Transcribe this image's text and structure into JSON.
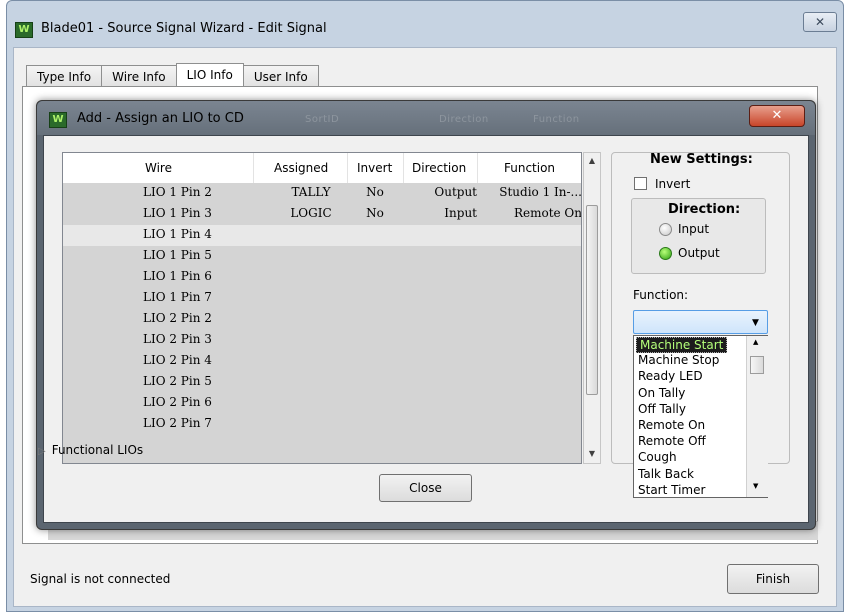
{
  "outer_window": {
    "title": "Blade01 - Source Signal Wizard - Edit Signal",
    "close_glyph": "✕"
  },
  "tabs": [
    "Type Info",
    "Wire Info",
    "LIO Info",
    "User Info"
  ],
  "active_tab": "LIO Info",
  "dialog": {
    "title": "Add - Assign an LIO to CD",
    "ghost_labels": [
      "SortID",
      "Direction",
      "Function"
    ],
    "close_glyph": "✕",
    "close_button": "Close"
  },
  "table": {
    "headers": [
      "Wire",
      "Assigned",
      "Invert",
      "Direction",
      "Function"
    ],
    "rows": [
      {
        "wire": "LIO 1 Pin 2",
        "assigned": "TALLY",
        "invert": "No",
        "direction": "Output",
        "function": "Studio 1 In-..."
      },
      {
        "wire": "LIO 1 Pin 3",
        "assigned": "LOGIC",
        "invert": "No",
        "direction": "Input",
        "function": "Remote On"
      },
      {
        "wire": "LIO 1 Pin 4",
        "assigned": "",
        "invert": "",
        "direction": "",
        "function": ""
      },
      {
        "wire": "LIO 1 Pin 5",
        "assigned": "",
        "invert": "",
        "direction": "",
        "function": ""
      },
      {
        "wire": "LIO 1 Pin 6",
        "assigned": "",
        "invert": "",
        "direction": "",
        "function": ""
      },
      {
        "wire": "LIO 1 Pin 7",
        "assigned": "",
        "invert": "",
        "direction": "",
        "function": ""
      },
      {
        "wire": "LIO 2 Pin 2",
        "assigned": "",
        "invert": "",
        "direction": "",
        "function": ""
      },
      {
        "wire": "LIO 2 Pin 3",
        "assigned": "",
        "invert": "",
        "direction": "",
        "function": ""
      },
      {
        "wire": "LIO 2 Pin 4",
        "assigned": "",
        "invert": "",
        "direction": "",
        "function": ""
      },
      {
        "wire": "LIO 2 Pin 5",
        "assigned": "",
        "invert": "",
        "direction": "",
        "function": ""
      },
      {
        "wire": "LIO 2 Pin 6",
        "assigned": "",
        "invert": "",
        "direction": "",
        "function": ""
      },
      {
        "wire": "LIO 2 Pin 7",
        "assigned": "",
        "invert": "",
        "direction": "",
        "function": ""
      }
    ],
    "highlighted_row": 2,
    "group_label": "Functional LIOs",
    "group_expander": "▷"
  },
  "settings": {
    "title": "New Settings:",
    "invert_label": "Invert",
    "invert_checked": false,
    "direction_title": "Direction:",
    "input_label": "Input",
    "output_label": "Output",
    "selected_direction": "Output",
    "function_label": "Function:",
    "function_value": "",
    "options": [
      "Machine Start",
      "Machine Stop",
      "Ready LED",
      "On Tally",
      "Off Tally",
      "Remote On",
      "Remote Off",
      "Cough",
      "Talk Back",
      "Start Timer"
    ],
    "selected_option": "Machine Start"
  },
  "status_text": "Signal is not connected",
  "finish_button": "Finish",
  "colors": {
    "selected_option_text": "#b4ff7a",
    "output_radio": "#2ea012",
    "dialog_frame": "#5b6570",
    "dialog_close": "#c8452a"
  }
}
